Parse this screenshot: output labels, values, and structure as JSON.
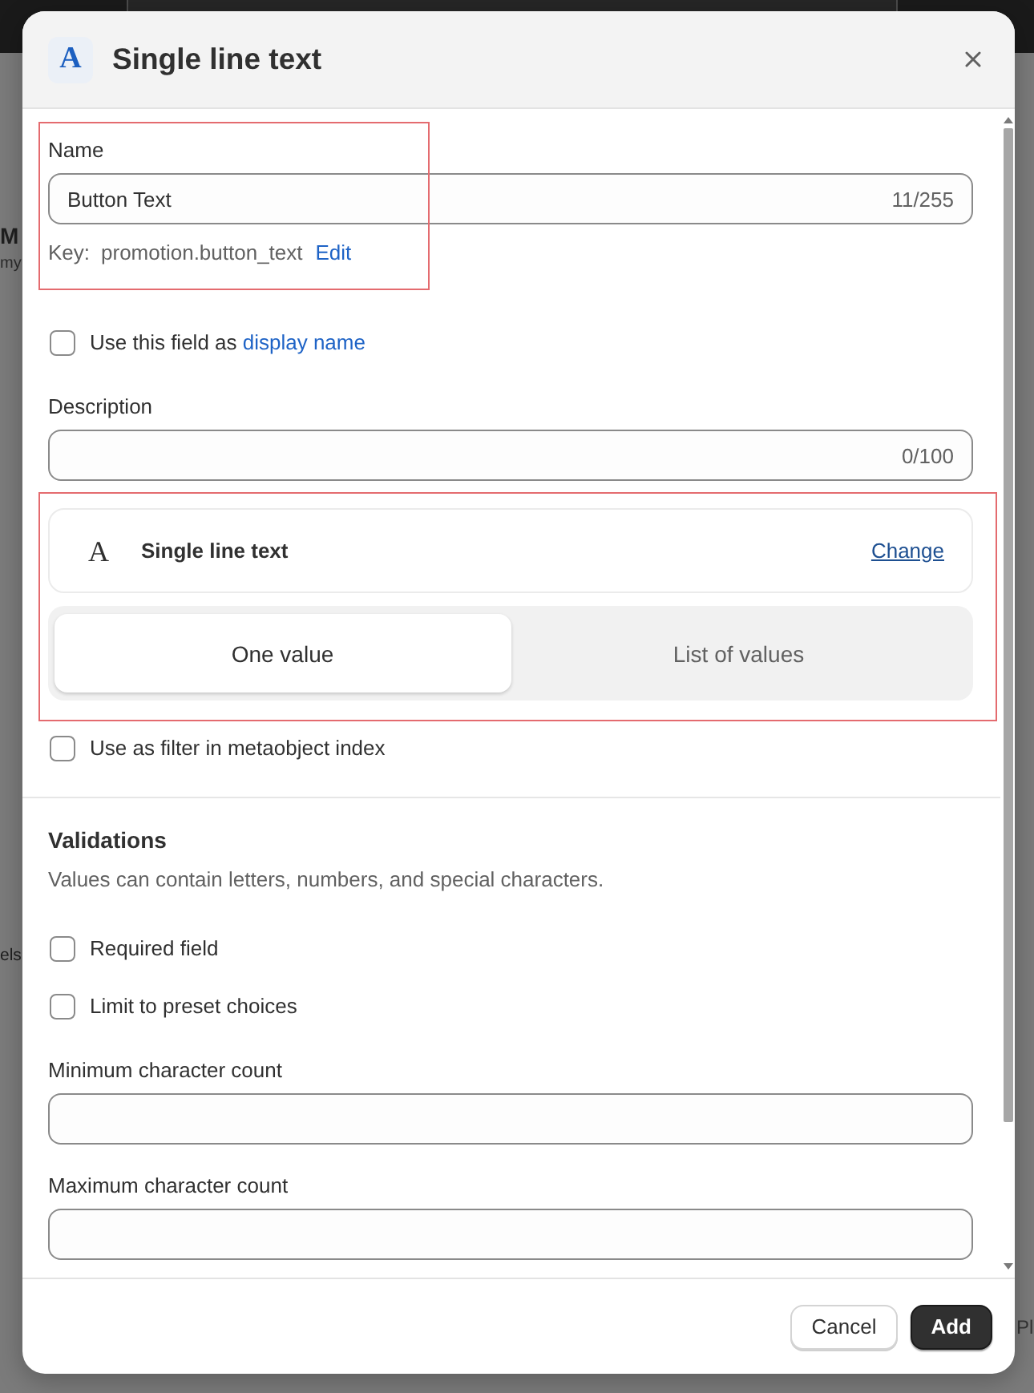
{
  "background": {
    "left_texts": [
      {
        "text": "M",
        "kind": "heading"
      },
      {
        "text": "my",
        "kind": "subheading"
      },
      {
        "text": "els",
        "kind": "sidebar_label"
      }
    ],
    "right_texts": [
      {
        "text": "Pl",
        "kind": "table_text"
      }
    ]
  },
  "dialog": {
    "type_icon": "A",
    "title": "Single line text",
    "name_field": {
      "label": "Name",
      "value": "Button Text",
      "counter": "11/255"
    },
    "key": {
      "label": "Key:",
      "value": "promotion.button_text",
      "link": "Edit"
    },
    "display_name_option": {
      "text": "Use this field as ",
      "link": "display name",
      "checked": false
    },
    "description_field": {
      "label": "Description",
      "counter": "0/100"
    },
    "type_card": {
      "icon": "A",
      "name": "Single line text",
      "link": "Change"
    },
    "value_modes": [
      {
        "label": "One value",
        "selected": true
      },
      {
        "label": "List of values",
        "selected": false
      }
    ],
    "filter_option": {
      "label": "Use as filter in metaobject index",
      "checked": false
    },
    "validations": {
      "title": "Validations",
      "description": "Values can contain letters, numbers, and special characters.",
      "options": [
        {
          "label": "Required field",
          "checked": false
        },
        {
          "label": "Limit to preset choices",
          "checked": false
        }
      ],
      "fields": [
        {
          "label": "Minimum character count"
        },
        {
          "label": "Maximum character count"
        }
      ]
    },
    "buttons": [
      {
        "label": "Cancel",
        "kind": "secondary"
      },
      {
        "label": "Add",
        "kind": "primary"
      }
    ]
  }
}
